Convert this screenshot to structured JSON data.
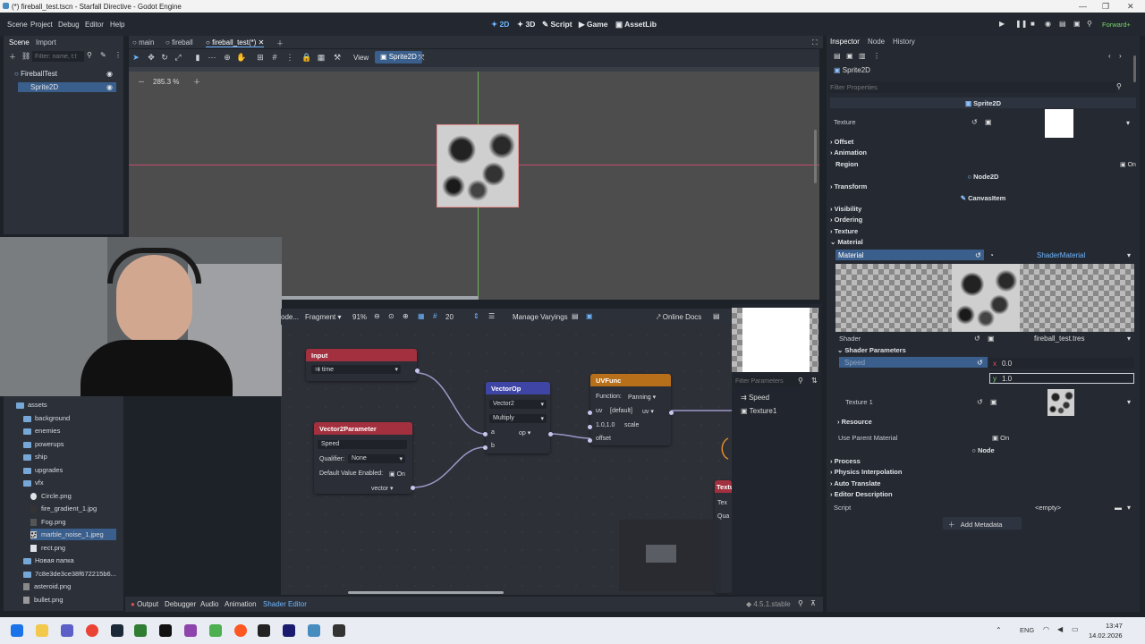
{
  "window": {
    "title": "(*) fireball_test.tscn - Starfall Directive - Godot Engine"
  },
  "menu": {
    "items": [
      "Scene",
      "Project",
      "Debug",
      "Editor",
      "Help"
    ]
  },
  "modes": {
    "items": [
      "2D",
      "3D",
      "Script",
      "Game",
      "AssetLib"
    ],
    "renderer": "Forward+"
  },
  "scene_dock": {
    "tabs": [
      "Scene",
      "Import"
    ],
    "filter_placeholder": "Filter: name, t:t",
    "nodes": [
      {
        "name": "FireballTest"
      },
      {
        "name": "Sprite2D"
      }
    ]
  },
  "editor_tabs": [
    "main",
    "fireball",
    "fireball_test(*)"
  ],
  "viewport": {
    "view_label": "View",
    "selected_node": "Sprite2D",
    "zoom": "285.3 %"
  },
  "filesystem": {
    "items": [
      "assets",
      "background",
      "enemies",
      "powerups",
      "ship",
      "upgrades",
      "vfx",
      "Circle.png",
      "fire_gradient_1.jpg",
      "Fog.png",
      "marble_noise_1.jpeg",
      "rect.png",
      "Новая папка",
      "7c8e3de3ce38f672215b6...",
      "asteroid.png",
      "bullet.png"
    ],
    "selected": "marble_noise_1.jpeg"
  },
  "shader_editor": {
    "mode": "Fragment",
    "zoom": "91%",
    "snap": "20",
    "manage_varyings": "Manage Varyings",
    "online_docs": "Online Docs",
    "filter_params_placeholder": "Filter Parameters",
    "params": [
      "Speed",
      "Texture1"
    ],
    "partial_label": "ode...",
    "nodes": {
      "input": {
        "title": "Input",
        "field": "time"
      },
      "vec2param": {
        "title": "Vector2Parameter",
        "name": "Speed",
        "qualifier_label": "Qualifier:",
        "qualifier": "None",
        "default_label": "Default Value Enabled:",
        "default_on": "On",
        "out": "vector"
      },
      "vectorop": {
        "title": "VectorOp",
        "type": "Vector2",
        "op": "Multiply",
        "a": "a",
        "b": "b",
        "out": "op"
      },
      "uvfunc": {
        "title": "UVFunc",
        "function_label": "Function:",
        "function": "Panning",
        "uv_label": "uv",
        "uv_default": "[default]",
        "uv_out": "uv",
        "scale_val": "1.0,1.0",
        "scale_label": "scale",
        "offset_label": "offset"
      },
      "texture_partial": {
        "title": "Textu",
        "rows": [
          "Tex",
          "Qua"
        ]
      }
    }
  },
  "bottom_tabs": [
    "Output",
    "Debugger",
    "Audio",
    "Animation",
    "Shader Editor"
  ],
  "version": "4.5.1.stable",
  "inspector": {
    "tabs": [
      "Inspector",
      "Node",
      "History"
    ],
    "object": "Sprite2D",
    "filter_placeholder": "Filter Properties",
    "class_header": "Sprite2D",
    "texture_label": "Texture",
    "sections1": [
      "Offset",
      "Animation",
      "Region"
    ],
    "region_on": "On",
    "node2d": "Node2D",
    "transform": "Transform",
    "canvasitem": "CanvasItem",
    "sections2": [
      "Visibility",
      "Ordering",
      "Texture",
      "Material"
    ],
    "material_label": "Material",
    "material_value": "ShaderMaterial",
    "shader_label": "Shader",
    "shader_value": "fireball_test.tres",
    "shader_params": "Shader Parameters",
    "speed_label": "Speed",
    "speed_x_axis": "x",
    "speed_x": "0.0",
    "speed_y_axis": "y",
    "speed_y": "1.0",
    "texture1_label": "Texture 1",
    "resource": "Resource",
    "use_parent_label": "Use Parent Material",
    "use_parent_on": "On",
    "node": "Node",
    "sections3": [
      "Process",
      "Physics Interpolation",
      "Auto Translate",
      "Editor Description"
    ],
    "script_label": "Script",
    "script_value": "<empty>",
    "add_metadata": "Add Metadata"
  },
  "taskbar": {
    "lang": "ENG",
    "time": "13:47",
    "date": "14.02.2026"
  }
}
